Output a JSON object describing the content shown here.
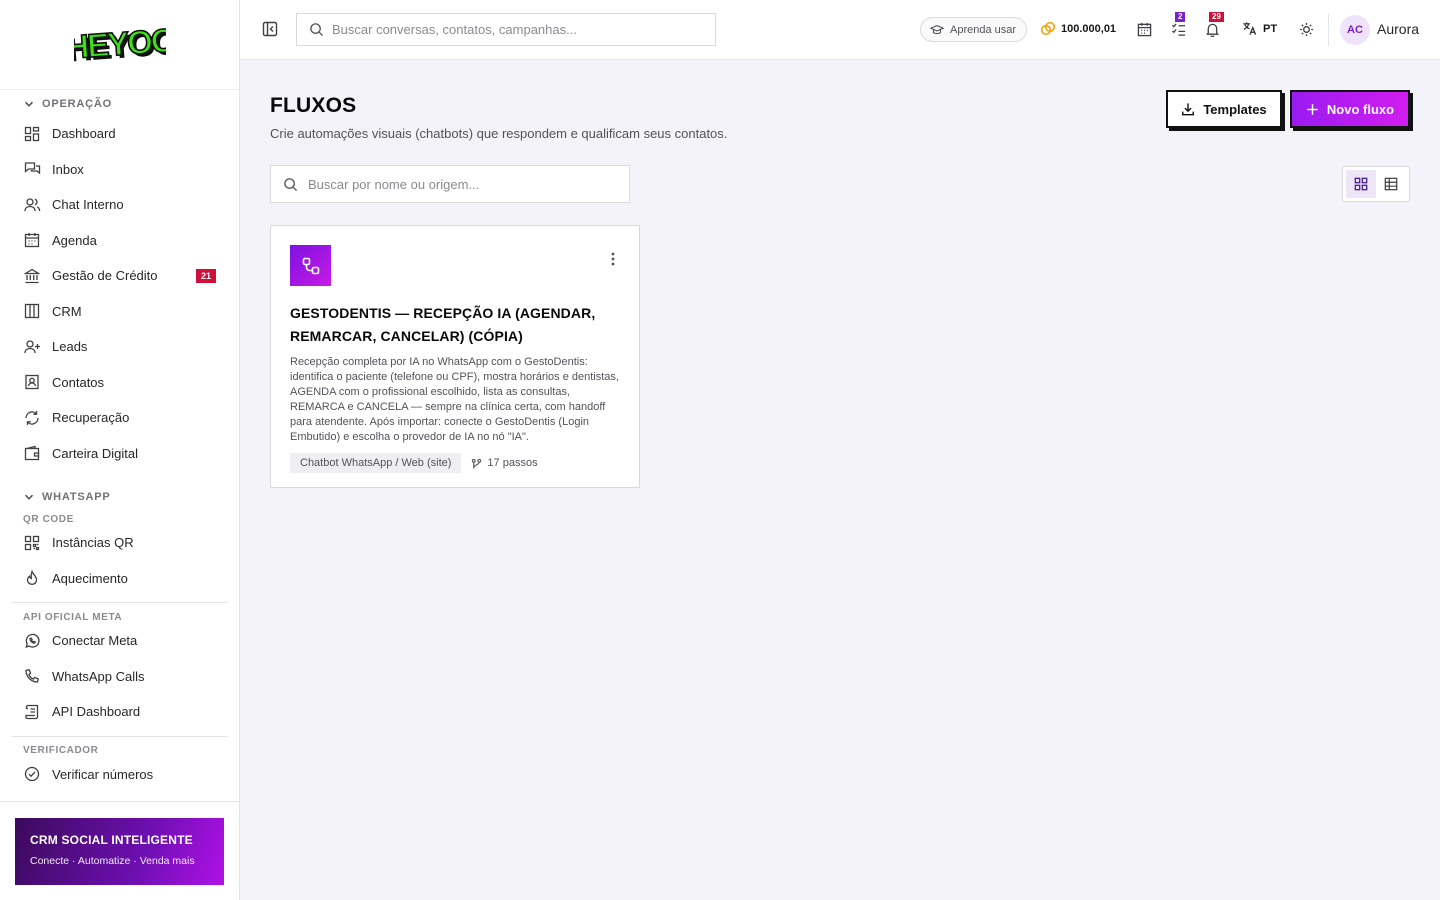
{
  "brand": {
    "logo_text": "HEYOO"
  },
  "sidebar": {
    "section_operacao": "OPERAÇÃO",
    "operacao_items": [
      {
        "label": "Dashboard",
        "icon": "dashboard-icon"
      },
      {
        "label": "Inbox",
        "icon": "inbox-icon"
      },
      {
        "label": "Chat Interno",
        "icon": "users-icon"
      },
      {
        "label": "Agenda",
        "icon": "calendar-icon"
      },
      {
        "label": "Gestão de Crédito",
        "icon": "bank-icon",
        "badge": "21"
      },
      {
        "label": "CRM",
        "icon": "kanban-icon"
      },
      {
        "label": "Leads",
        "icon": "user-plus-icon"
      },
      {
        "label": "Contatos",
        "icon": "contact-icon"
      },
      {
        "label": "Recuperação",
        "icon": "refresh-icon"
      },
      {
        "label": "Carteira Digital",
        "icon": "wallet-icon"
      }
    ],
    "section_whatsapp": "WHATSAPP",
    "sub_qr": "QR CODE",
    "qr_items": [
      {
        "label": "Instâncias QR",
        "icon": "qr-icon"
      },
      {
        "label": "Aquecimento",
        "icon": "flame-icon"
      }
    ],
    "sub_api": "API OFICIAL META",
    "api_items": [
      {
        "label": "Conectar Meta",
        "icon": "whatsapp-icon"
      },
      {
        "label": "WhatsApp Calls",
        "icon": "phone-icon"
      },
      {
        "label": "API Dashboard",
        "icon": "scroll-icon"
      }
    ],
    "sub_verificador": "VERIFICADOR",
    "verificador_items": [
      {
        "label": "Verificar números",
        "icon": "check-circle-icon"
      }
    ],
    "promo": {
      "title": "CRM SOCIAL INTELIGENTE",
      "subtitle": "Conecte · Automatize · Venda mais"
    }
  },
  "header": {
    "search_placeholder": "Buscar conversas, contatos, campanhas...",
    "learn_label": "Aprenda usar",
    "credits": "100.000,01",
    "tasks_badge": "2",
    "notifications_badge": "29",
    "language": "PT",
    "avatar_initials": "AC",
    "username": "Aurora",
    "colors": {
      "tasks_badge": "#7c1fd0",
      "notifications_badge": "#d0103a"
    }
  },
  "page": {
    "title": "FLUXOS",
    "subtitle": "Crie automações visuais (chatbots) que respondem e qualificam seus contatos.",
    "templates_label": "Templates",
    "new_flow_label": "Novo fluxo",
    "search_placeholder": "Buscar por nome ou origem...",
    "view_mode": "grid"
  },
  "flows": [
    {
      "title": "GESTODENTIS — RECEPÇÃO IA (AGENDAR, REMARCAR, CANCELAR) (CÓPIA)",
      "description": "Recepção completa por IA no WhatsApp com o GestoDentis: identifica o paciente (telefone ou CPF), mostra horários e dentistas, AGENDA com o profissional escolhido, lista as consultas, REMARCA e CANCELA — sempre na clínica certa, com handoff para atendente. Após importar: conecte o GestoDentis (Login Embutido) e escolha o provedor de IA no nó \"IA\".",
      "tag": "Chatbot WhatsApp / Web (site)",
      "steps": "17 passos"
    }
  ],
  "accent_colors": {
    "primary": "#9a1cf0",
    "logo_green": "#3fe01a"
  }
}
